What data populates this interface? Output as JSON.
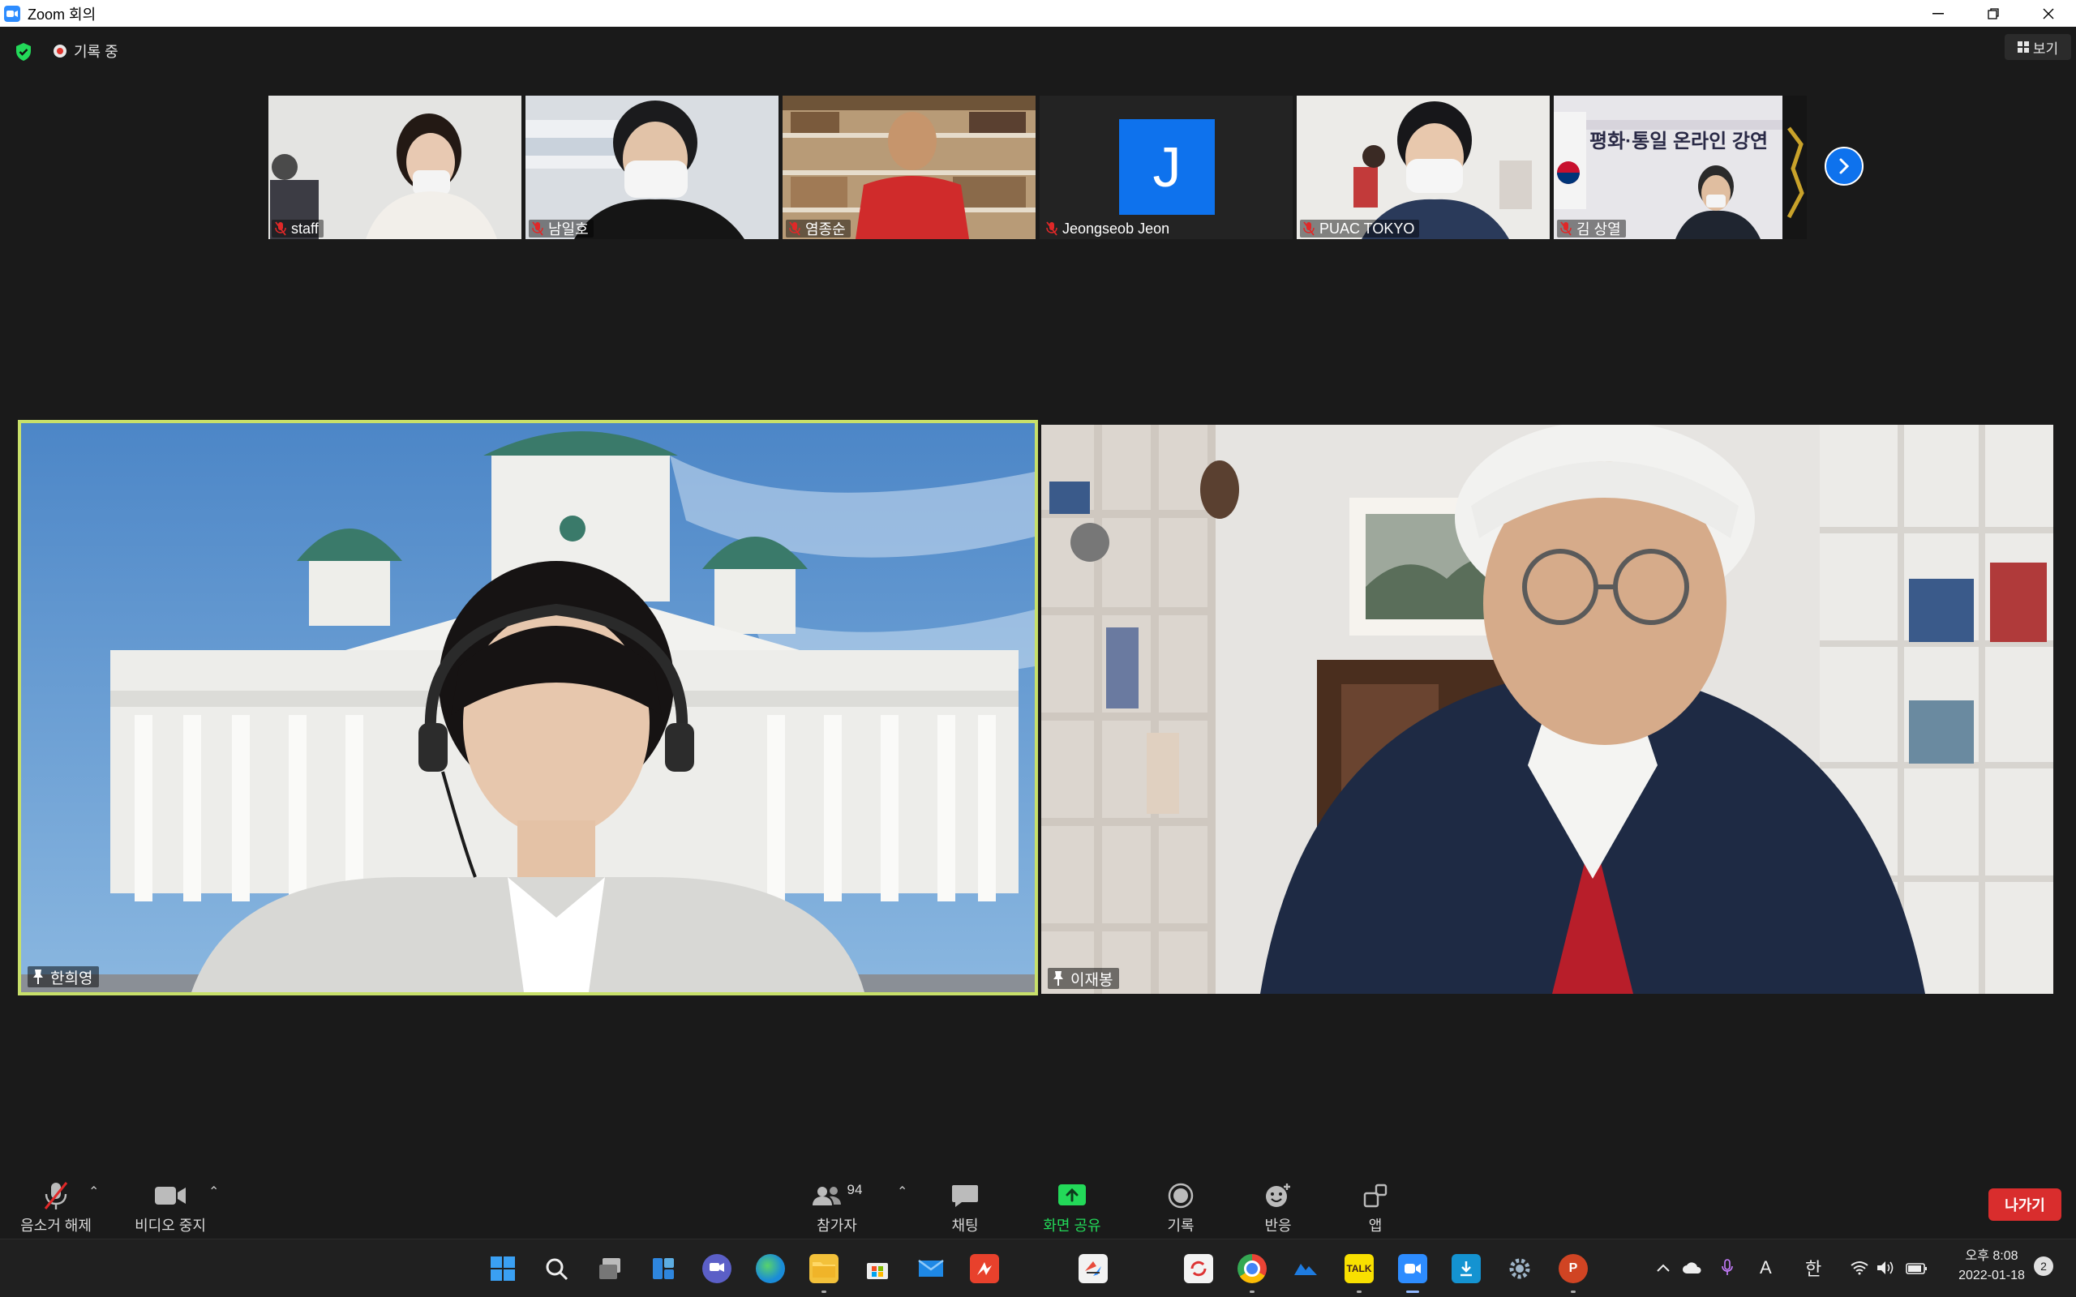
{
  "window": {
    "title": "Zoom 회의"
  },
  "status": {
    "recording_label": "기록 중",
    "view_label": "보기"
  },
  "thumbnails": [
    {
      "name": "staff"
    },
    {
      "name": "남일호"
    },
    {
      "name": "염종순"
    },
    {
      "name": "Jeongseob Jeon",
      "avatar_letter": "J"
    },
    {
      "name": "PUAC TOKYO"
    },
    {
      "name": "김 상열",
      "banner_text": "평화·통일 온라인 강연"
    }
  ],
  "main_tiles": [
    {
      "name": "한희영"
    },
    {
      "name": "이재봉"
    }
  ],
  "toolbar": {
    "unmute": "음소거 해제",
    "stop_video": "비디오 중지",
    "participants": "참가자",
    "participants_count": "94",
    "chat": "채팅",
    "share_screen": "화면 공유",
    "record": "기록",
    "reactions": "반응",
    "apps": "앱",
    "leave": "나가기"
  },
  "taskbar": {
    "tray_lang": "A",
    "tray_ime": "한",
    "clock_time": "오후 8:08",
    "clock_date": "2022-01-18",
    "notification_count": "2"
  },
  "colors": {
    "zoom_blue": "#0e72ed",
    "active_speaker_border": "#c8e06a",
    "leave_red": "#d92d2d",
    "share_green": "#23d959"
  }
}
